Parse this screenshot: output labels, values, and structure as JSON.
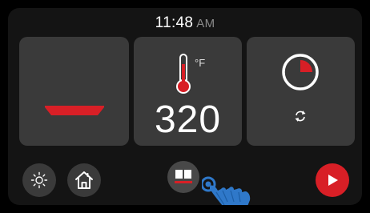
{
  "status_bar": {
    "time": "11:48",
    "ampm": "AM"
  },
  "cards": {
    "pan": {
      "icon": "pan-icon"
    },
    "temperature": {
      "icon": "thermometer-icon",
      "unit": "°F",
      "value": "320"
    },
    "timer": {
      "icon": "timer-dial-icon",
      "secondary_icon": "repeat-icon",
      "fill_fraction": 0.25
    }
  },
  "bottom_bar": {
    "brightness": {
      "icon": "brightness-icon"
    },
    "home": {
      "icon": "home-icon"
    },
    "recipes": {
      "icon": "recipe-book-icon"
    },
    "start": {
      "icon": "play-icon"
    }
  },
  "colors": {
    "accent": "#d81f26",
    "card": "#3a3a3a",
    "background": "#141414"
  }
}
